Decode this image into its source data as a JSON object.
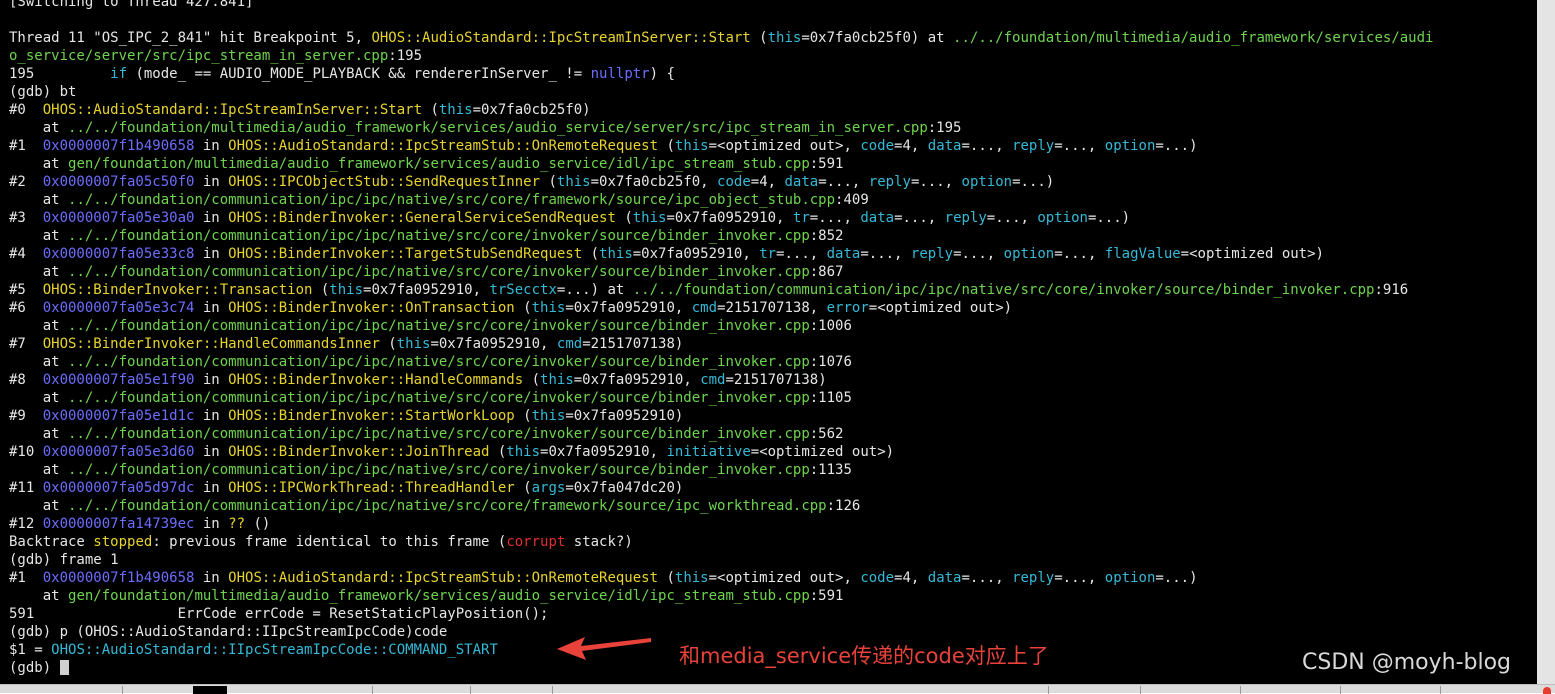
{
  "terminal": {
    "lines": [
      [
        [
          "white",
          "[Switching to Thread 427.841]"
        ]
      ],
      [],
      [
        [
          "white",
          "Thread 11 \"OS_IPC_2_841\" hit Breakpoint 5, "
        ],
        [
          "yellow",
          "OHOS::AudioStandard::IpcStreamInServer::Start"
        ],
        [
          "white",
          " ("
        ],
        [
          "cyan",
          "this"
        ],
        [
          "white",
          "=0x7fa0cb25f0) at "
        ],
        [
          "green",
          "../../foundation/multimedia/audio_framework/services/audi"
        ]
      ],
      [
        [
          "green",
          "o_service/server/src/ipc_stream_in_server.cpp"
        ],
        [
          "white",
          ":195"
        ]
      ],
      [
        [
          "white",
          "195         "
        ],
        [
          "cyan",
          "if"
        ],
        [
          "white",
          " (mode_ == AUDIO_MODE_PLAYBACK && rendererInServer_ != "
        ],
        [
          "blue",
          "nullptr"
        ],
        [
          "white",
          ") {"
        ]
      ],
      [
        [
          "white",
          "(gdb) bt"
        ]
      ],
      [
        [
          "white",
          "#0  "
        ],
        [
          "yellow",
          "OHOS::AudioStandard::IpcStreamInServer::Start"
        ],
        [
          "white",
          " ("
        ],
        [
          "cyan",
          "this"
        ],
        [
          "white",
          "=0x7fa0cb25f0)"
        ]
      ],
      [
        [
          "white",
          "    at "
        ],
        [
          "green",
          "../../foundation/multimedia/audio_framework/services/audio_service/server/src/ipc_stream_in_server.cpp"
        ],
        [
          "white",
          ":195"
        ]
      ],
      [
        [
          "white",
          "#1  "
        ],
        [
          "blue",
          "0x0000007f1b490658"
        ],
        [
          "white",
          " in "
        ],
        [
          "yellow",
          "OHOS::AudioStandard::IpcStreamStub::OnRemoteRequest"
        ],
        [
          "white",
          " ("
        ],
        [
          "cyan",
          "this"
        ],
        [
          "white",
          "=<optimized out>, "
        ],
        [
          "cyan",
          "code"
        ],
        [
          "white",
          "=4, "
        ],
        [
          "cyan",
          "data"
        ],
        [
          "white",
          "=..., "
        ],
        [
          "cyan",
          "reply"
        ],
        [
          "white",
          "=..., "
        ],
        [
          "cyan",
          "option"
        ],
        [
          "white",
          "=...)"
        ]
      ],
      [
        [
          "white",
          "    at "
        ],
        [
          "green",
          "gen/foundation/multimedia/audio_framework/services/audio_service/idl/ipc_stream_stub.cpp"
        ],
        [
          "white",
          ":591"
        ]
      ],
      [
        [
          "white",
          "#2  "
        ],
        [
          "blue",
          "0x0000007fa05c50f0"
        ],
        [
          "white",
          " in "
        ],
        [
          "yellow",
          "OHOS::IPCObjectStub::SendRequestInner"
        ],
        [
          "white",
          " ("
        ],
        [
          "cyan",
          "this"
        ],
        [
          "white",
          "=0x7fa0cb25f0, "
        ],
        [
          "cyan",
          "code"
        ],
        [
          "white",
          "=4, "
        ],
        [
          "cyan",
          "data"
        ],
        [
          "white",
          "=..., "
        ],
        [
          "cyan",
          "reply"
        ],
        [
          "white",
          "=..., "
        ],
        [
          "cyan",
          "option"
        ],
        [
          "white",
          "=...)"
        ]
      ],
      [
        [
          "white",
          "    at "
        ],
        [
          "green",
          "../../foundation/communication/ipc/ipc/native/src/core/framework/source/ipc_object_stub.cpp"
        ],
        [
          "white",
          ":409"
        ]
      ],
      [
        [
          "white",
          "#3  "
        ],
        [
          "blue",
          "0x0000007fa05e30a0"
        ],
        [
          "white",
          " in "
        ],
        [
          "yellow",
          "OHOS::BinderInvoker::GeneralServiceSendRequest"
        ],
        [
          "white",
          " ("
        ],
        [
          "cyan",
          "this"
        ],
        [
          "white",
          "=0x7fa0952910, "
        ],
        [
          "cyan",
          "tr"
        ],
        [
          "white",
          "=..., "
        ],
        [
          "cyan",
          "data"
        ],
        [
          "white",
          "=..., "
        ],
        [
          "cyan",
          "reply"
        ],
        [
          "white",
          "=..., "
        ],
        [
          "cyan",
          "option"
        ],
        [
          "white",
          "=...)"
        ]
      ],
      [
        [
          "white",
          "    at "
        ],
        [
          "green",
          "../../foundation/communication/ipc/ipc/native/src/core/invoker/source/binder_invoker.cpp"
        ],
        [
          "white",
          ":852"
        ]
      ],
      [
        [
          "white",
          "#4  "
        ],
        [
          "blue",
          "0x0000007fa05e33c8"
        ],
        [
          "white",
          " in "
        ],
        [
          "yellow",
          "OHOS::BinderInvoker::TargetStubSendRequest"
        ],
        [
          "white",
          " ("
        ],
        [
          "cyan",
          "this"
        ],
        [
          "white",
          "=0x7fa0952910, "
        ],
        [
          "cyan",
          "tr"
        ],
        [
          "white",
          "=..., "
        ],
        [
          "cyan",
          "data"
        ],
        [
          "white",
          "=..., "
        ],
        [
          "cyan",
          "reply"
        ],
        [
          "white",
          "=..., "
        ],
        [
          "cyan",
          "option"
        ],
        [
          "white",
          "=..., "
        ],
        [
          "cyan",
          "flagValue"
        ],
        [
          "white",
          "=<optimized out>)"
        ]
      ],
      [
        [
          "white",
          "    at "
        ],
        [
          "green",
          "../../foundation/communication/ipc/ipc/native/src/core/invoker/source/binder_invoker.cpp"
        ],
        [
          "white",
          ":867"
        ]
      ],
      [
        [
          "white",
          "#5  "
        ],
        [
          "yellow",
          "OHOS::BinderInvoker::Transaction"
        ],
        [
          "white",
          " ("
        ],
        [
          "cyan",
          "this"
        ],
        [
          "white",
          "=0x7fa0952910, "
        ],
        [
          "cyan",
          "trSecctx"
        ],
        [
          "white",
          "=...) at "
        ],
        [
          "green",
          "../../foundation/communication/ipc/ipc/native/src/core/invoker/source/binder_invoker.cpp"
        ],
        [
          "white",
          ":916"
        ]
      ],
      [
        [
          "white",
          "#6  "
        ],
        [
          "blue",
          "0x0000007fa05e3c74"
        ],
        [
          "white",
          " in "
        ],
        [
          "yellow",
          "OHOS::BinderInvoker::OnTransaction"
        ],
        [
          "white",
          " ("
        ],
        [
          "cyan",
          "this"
        ],
        [
          "white",
          "=0x7fa0952910, "
        ],
        [
          "cyan",
          "cmd"
        ],
        [
          "white",
          "=2151707138, "
        ],
        [
          "cyan",
          "error"
        ],
        [
          "white",
          "=<optimized out>)"
        ]
      ],
      [
        [
          "white",
          "    at "
        ],
        [
          "green",
          "../../foundation/communication/ipc/ipc/native/src/core/invoker/source/binder_invoker.cpp"
        ],
        [
          "white",
          ":1006"
        ]
      ],
      [
        [
          "white",
          "#7  "
        ],
        [
          "yellow",
          "OHOS::BinderInvoker::HandleCommandsInner"
        ],
        [
          "white",
          " ("
        ],
        [
          "cyan",
          "this"
        ],
        [
          "white",
          "=0x7fa0952910, "
        ],
        [
          "cyan",
          "cmd"
        ],
        [
          "white",
          "=2151707138)"
        ]
      ],
      [
        [
          "white",
          "    at "
        ],
        [
          "green",
          "../../foundation/communication/ipc/ipc/native/src/core/invoker/source/binder_invoker.cpp"
        ],
        [
          "white",
          ":1076"
        ]
      ],
      [
        [
          "white",
          "#8  "
        ],
        [
          "blue",
          "0x0000007fa05e1f90"
        ],
        [
          "white",
          " in "
        ],
        [
          "yellow",
          "OHOS::BinderInvoker::HandleCommands"
        ],
        [
          "white",
          " ("
        ],
        [
          "cyan",
          "this"
        ],
        [
          "white",
          "=0x7fa0952910, "
        ],
        [
          "cyan",
          "cmd"
        ],
        [
          "white",
          "=2151707138)"
        ]
      ],
      [
        [
          "white",
          "    at "
        ],
        [
          "green",
          "../../foundation/communication/ipc/ipc/native/src/core/invoker/source/binder_invoker.cpp"
        ],
        [
          "white",
          ":1105"
        ]
      ],
      [
        [
          "white",
          "#9  "
        ],
        [
          "blue",
          "0x0000007fa05e1d1c"
        ],
        [
          "white",
          " in "
        ],
        [
          "yellow",
          "OHOS::BinderInvoker::StartWorkLoop"
        ],
        [
          "white",
          " ("
        ],
        [
          "cyan",
          "this"
        ],
        [
          "white",
          "=0x7fa0952910)"
        ]
      ],
      [
        [
          "white",
          "    at "
        ],
        [
          "green",
          "../../foundation/communication/ipc/ipc/native/src/core/invoker/source/binder_invoker.cpp"
        ],
        [
          "white",
          ":562"
        ]
      ],
      [
        [
          "white",
          "#10 "
        ],
        [
          "blue",
          "0x0000007fa05e3d60"
        ],
        [
          "white",
          " in "
        ],
        [
          "yellow",
          "OHOS::BinderInvoker::JoinThread"
        ],
        [
          "white",
          " ("
        ],
        [
          "cyan",
          "this"
        ],
        [
          "white",
          "=0x7fa0952910, "
        ],
        [
          "cyan",
          "initiative"
        ],
        [
          "white",
          "=<optimized out>)"
        ]
      ],
      [
        [
          "white",
          "    at "
        ],
        [
          "green",
          "../../foundation/communication/ipc/ipc/native/src/core/invoker/source/binder_invoker.cpp"
        ],
        [
          "white",
          ":1135"
        ]
      ],
      [
        [
          "white",
          "#11 "
        ],
        [
          "blue",
          "0x0000007fa05d97dc"
        ],
        [
          "white",
          " in "
        ],
        [
          "yellow",
          "OHOS::IPCWorkThread::ThreadHandler"
        ],
        [
          "white",
          " ("
        ],
        [
          "cyan",
          "args"
        ],
        [
          "white",
          "=0x7fa047dc20)"
        ]
      ],
      [
        [
          "white",
          "    at "
        ],
        [
          "green",
          "../../foundation/communication/ipc/ipc/native/src/core/framework/source/ipc_workthread.cpp"
        ],
        [
          "white",
          ":126"
        ]
      ],
      [
        [
          "white",
          "#12 "
        ],
        [
          "blue",
          "0x0000007fa14739ec"
        ],
        [
          "white",
          " in "
        ],
        [
          "yellow",
          "??"
        ],
        [
          "white",
          " ()"
        ]
      ],
      [
        [
          "white",
          "Backtrace "
        ],
        [
          "yellow",
          "stopped"
        ],
        [
          "white",
          ": previous frame identical to this frame ("
        ],
        [
          "red",
          "corrupt"
        ],
        [
          "white",
          " stack?)"
        ]
      ],
      [
        [
          "white",
          "(gdb) frame 1"
        ]
      ],
      [
        [
          "white",
          "#1  "
        ],
        [
          "blue",
          "0x0000007f1b490658"
        ],
        [
          "white",
          " in "
        ],
        [
          "yellow",
          "OHOS::AudioStandard::IpcStreamStub::OnRemoteRequest"
        ],
        [
          "white",
          " ("
        ],
        [
          "cyan",
          "this"
        ],
        [
          "white",
          "=<optimized out>, "
        ],
        [
          "cyan",
          "code"
        ],
        [
          "white",
          "=4, "
        ],
        [
          "cyan",
          "data"
        ],
        [
          "white",
          "=..., "
        ],
        [
          "cyan",
          "reply"
        ],
        [
          "white",
          "=..., "
        ],
        [
          "cyan",
          "option"
        ],
        [
          "white",
          "=...)"
        ]
      ],
      [
        [
          "white",
          "    at "
        ],
        [
          "green",
          "gen/foundation/multimedia/audio_framework/services/audio_service/idl/ipc_stream_stub.cpp"
        ],
        [
          "white",
          ":591"
        ]
      ],
      [
        [
          "white",
          "591                 ErrCode errCode = ResetStaticPlayPosition();"
        ]
      ],
      [
        [
          "white",
          "(gdb) p (OHOS::AudioStandard::IIpcStreamIpcCode)code"
        ]
      ],
      [
        [
          "white",
          "$1 = "
        ],
        [
          "cyan",
          "OHOS::AudioStandard::IIpcStreamIpcCode::COMMAND_START"
        ]
      ],
      [
        [
          "white",
          "(gdb) "
        ]
      ]
    ]
  },
  "annotation": {
    "text": "和media_service传递的code对应上了"
  },
  "watermark": {
    "text": "CSDN @moyh-blog"
  },
  "colors": {
    "background": "#000000",
    "text": "#e6e6e6",
    "function": "#e6d32e",
    "path": "#6fd34f",
    "param": "#35b9d6",
    "address": "#6d6dff",
    "error": "#e03030",
    "annotation": "#e8423a"
  }
}
